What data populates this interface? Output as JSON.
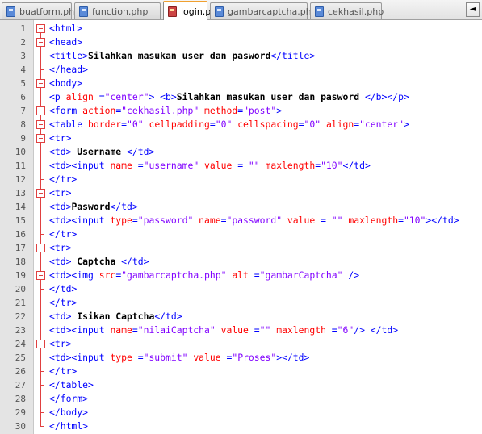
{
  "tabs": [
    {
      "label": "buatform.php",
      "active": false
    },
    {
      "label": "function.php",
      "active": false
    },
    {
      "label": "login.php",
      "active": true
    },
    {
      "label": "gambarcaptcha.php",
      "active": false
    },
    {
      "label": "cekhasil.php",
      "active": false
    }
  ],
  "nav": {
    "left_arrow": "◄"
  },
  "colors": {
    "tag": "#0000ff",
    "attribute": "#ff0000",
    "value": "#8000ff",
    "text": "#000000",
    "fold": "#e04040",
    "active_tab_accent": "#f0a030"
  },
  "lines": [
    {
      "n": "1",
      "fold": "open",
      "tokens": [
        [
          "tag",
          "<html>"
        ]
      ]
    },
    {
      "n": "2",
      "fold": "open",
      "tokens": [
        [
          "tag",
          "<head>"
        ]
      ]
    },
    {
      "n": "3",
      "fold": "mid",
      "tokens": [
        [
          "tag",
          "<title>"
        ],
        [
          "txt",
          "Silahkan masukan user dan pasword"
        ],
        [
          "tag",
          "</title>"
        ]
      ]
    },
    {
      "n": "4",
      "fold": "end",
      "tokens": [
        [
          "tag",
          "</head>"
        ]
      ]
    },
    {
      "n": "5",
      "fold": "open",
      "tokens": [
        [
          "tag",
          "<body>"
        ]
      ]
    },
    {
      "n": "6",
      "fold": "mid",
      "tokens": [
        [
          "tag",
          "<p "
        ],
        [
          "attr",
          "align "
        ],
        [
          "tag",
          "="
        ],
        [
          "val",
          "\"center\""
        ],
        [
          "tag",
          "> <b>"
        ],
        [
          "txt",
          "Silahkan masukan user dan pasword "
        ],
        [
          "tag",
          "</b></p>"
        ]
      ]
    },
    {
      "n": "7",
      "fold": "open",
      "tokens": [
        [
          "tag",
          "<form "
        ],
        [
          "attr",
          "action"
        ],
        [
          "tag",
          "="
        ],
        [
          "val",
          "\"cekhasil.php\""
        ],
        [
          "tag",
          " "
        ],
        [
          "attr",
          "method"
        ],
        [
          "tag",
          "="
        ],
        [
          "val",
          "\"post\""
        ],
        [
          "tag",
          ">"
        ]
      ]
    },
    {
      "n": "8",
      "fold": "open",
      "tokens": [
        [
          "tag",
          "<table "
        ],
        [
          "attr",
          "border"
        ],
        [
          "tag",
          "="
        ],
        [
          "val",
          "\"0\""
        ],
        [
          "tag",
          " "
        ],
        [
          "attr",
          "cellpadding"
        ],
        [
          "tag",
          "="
        ],
        [
          "val",
          "\"0\""
        ],
        [
          "tag",
          " "
        ],
        [
          "attr",
          "cellspacing"
        ],
        [
          "tag",
          "="
        ],
        [
          "val",
          "\"0\""
        ],
        [
          "tag",
          " "
        ],
        [
          "attr",
          "align"
        ],
        [
          "tag",
          "="
        ],
        [
          "val",
          "\"center\""
        ],
        [
          "tag",
          ">"
        ]
      ]
    },
    {
      "n": "9",
      "fold": "open",
      "tokens": [
        [
          "tag",
          "<tr>"
        ]
      ]
    },
    {
      "n": "10",
      "fold": "mid",
      "tokens": [
        [
          "tag",
          "<td>"
        ],
        [
          "txt",
          " Username "
        ],
        [
          "tag",
          "</td>"
        ]
      ]
    },
    {
      "n": "11",
      "fold": "mid",
      "tokens": [
        [
          "tag",
          "<td><input "
        ],
        [
          "attr",
          "name "
        ],
        [
          "tag",
          "="
        ],
        [
          "val",
          "\"username\""
        ],
        [
          "tag",
          " "
        ],
        [
          "attr",
          "value "
        ],
        [
          "tag",
          "= "
        ],
        [
          "val",
          "\"\""
        ],
        [
          "tag",
          " "
        ],
        [
          "attr",
          "maxlength"
        ],
        [
          "tag",
          "="
        ],
        [
          "val",
          "\"10\""
        ],
        [
          "tag",
          "</td>"
        ]
      ]
    },
    {
      "n": "12",
      "fold": "end",
      "tokens": [
        [
          "tag",
          "</tr>"
        ]
      ]
    },
    {
      "n": "13",
      "fold": "open",
      "tokens": [
        [
          "tag",
          "<tr>"
        ]
      ]
    },
    {
      "n": "14",
      "fold": "mid",
      "tokens": [
        [
          "tag",
          "<td>"
        ],
        [
          "txt",
          "Pasword"
        ],
        [
          "tag",
          "</td>"
        ]
      ]
    },
    {
      "n": "15",
      "fold": "mid",
      "tokens": [
        [
          "tag",
          "<td><input "
        ],
        [
          "attr",
          "type"
        ],
        [
          "tag",
          "="
        ],
        [
          "val",
          "\"password\""
        ],
        [
          "tag",
          " "
        ],
        [
          "attr",
          "name"
        ],
        [
          "tag",
          "="
        ],
        [
          "val",
          "\"password\""
        ],
        [
          "tag",
          " "
        ],
        [
          "attr",
          "value "
        ],
        [
          "tag",
          "= "
        ],
        [
          "val",
          "\"\""
        ],
        [
          "tag",
          " "
        ],
        [
          "attr",
          "maxlength"
        ],
        [
          "tag",
          "="
        ],
        [
          "val",
          "\"10\""
        ],
        [
          "tag",
          "></td>"
        ]
      ]
    },
    {
      "n": "16",
      "fold": "end",
      "tokens": [
        [
          "tag",
          "</tr>"
        ]
      ]
    },
    {
      "n": "17",
      "fold": "open",
      "tokens": [
        [
          "tag",
          "<tr>"
        ]
      ]
    },
    {
      "n": "18",
      "fold": "mid",
      "tokens": [
        [
          "tag",
          "<td>"
        ],
        [
          "txt",
          " Captcha "
        ],
        [
          "tag",
          "</td>"
        ]
      ]
    },
    {
      "n": "19",
      "fold": "open",
      "tokens": [
        [
          "tag",
          "<td><img "
        ],
        [
          "attr",
          "src"
        ],
        [
          "tag",
          "="
        ],
        [
          "val",
          "\"gambarcaptcha.php\""
        ],
        [
          "tag",
          " "
        ],
        [
          "attr",
          "alt "
        ],
        [
          "tag",
          "="
        ],
        [
          "val",
          "\"gambarCaptcha\""
        ],
        [
          "tag",
          " />"
        ]
      ]
    },
    {
      "n": "20",
      "fold": "end",
      "tokens": [
        [
          "tag",
          "</td>"
        ]
      ]
    },
    {
      "n": "21",
      "fold": "end",
      "tokens": [
        [
          "tag",
          "</tr>"
        ]
      ]
    },
    {
      "n": "22",
      "fold": "mid",
      "tokens": [
        [
          "tag",
          "<td>"
        ],
        [
          "txt",
          " Isikan Captcha"
        ],
        [
          "tag",
          "</td>"
        ]
      ]
    },
    {
      "n": "23",
      "fold": "mid",
      "tokens": [
        [
          "tag",
          "<td><input "
        ],
        [
          "attr",
          "name"
        ],
        [
          "tag",
          "="
        ],
        [
          "val",
          "\"nilaiCaptcha\""
        ],
        [
          "tag",
          " "
        ],
        [
          "attr",
          "value "
        ],
        [
          "tag",
          "="
        ],
        [
          "val",
          "\"\""
        ],
        [
          "tag",
          " "
        ],
        [
          "attr",
          "maxlength "
        ],
        [
          "tag",
          "="
        ],
        [
          "val",
          "\"6\""
        ],
        [
          "tag",
          "/> </td>"
        ]
      ]
    },
    {
      "n": "24",
      "fold": "open",
      "tokens": [
        [
          "tag",
          "<tr>"
        ]
      ]
    },
    {
      "n": "25",
      "fold": "mid",
      "tokens": [
        [
          "tag",
          "<td><input "
        ],
        [
          "attr",
          "type "
        ],
        [
          "tag",
          "="
        ],
        [
          "val",
          "\"submit\""
        ],
        [
          "tag",
          " "
        ],
        [
          "attr",
          "value "
        ],
        [
          "tag",
          "="
        ],
        [
          "val",
          "\"Proses\""
        ],
        [
          "tag",
          "></td>"
        ]
      ]
    },
    {
      "n": "26",
      "fold": "end",
      "tokens": [
        [
          "tag",
          "</tr>"
        ]
      ]
    },
    {
      "n": "27",
      "fold": "end",
      "tokens": [
        [
          "tag",
          "</table>"
        ]
      ]
    },
    {
      "n": "28",
      "fold": "end",
      "tokens": [
        [
          "tag",
          "</form>"
        ]
      ]
    },
    {
      "n": "29",
      "fold": "end",
      "tokens": [
        [
          "tag",
          "</body>"
        ]
      ]
    },
    {
      "n": "30",
      "fold": "end",
      "tokens": [
        [
          "tag",
          "</html>"
        ]
      ]
    }
  ]
}
